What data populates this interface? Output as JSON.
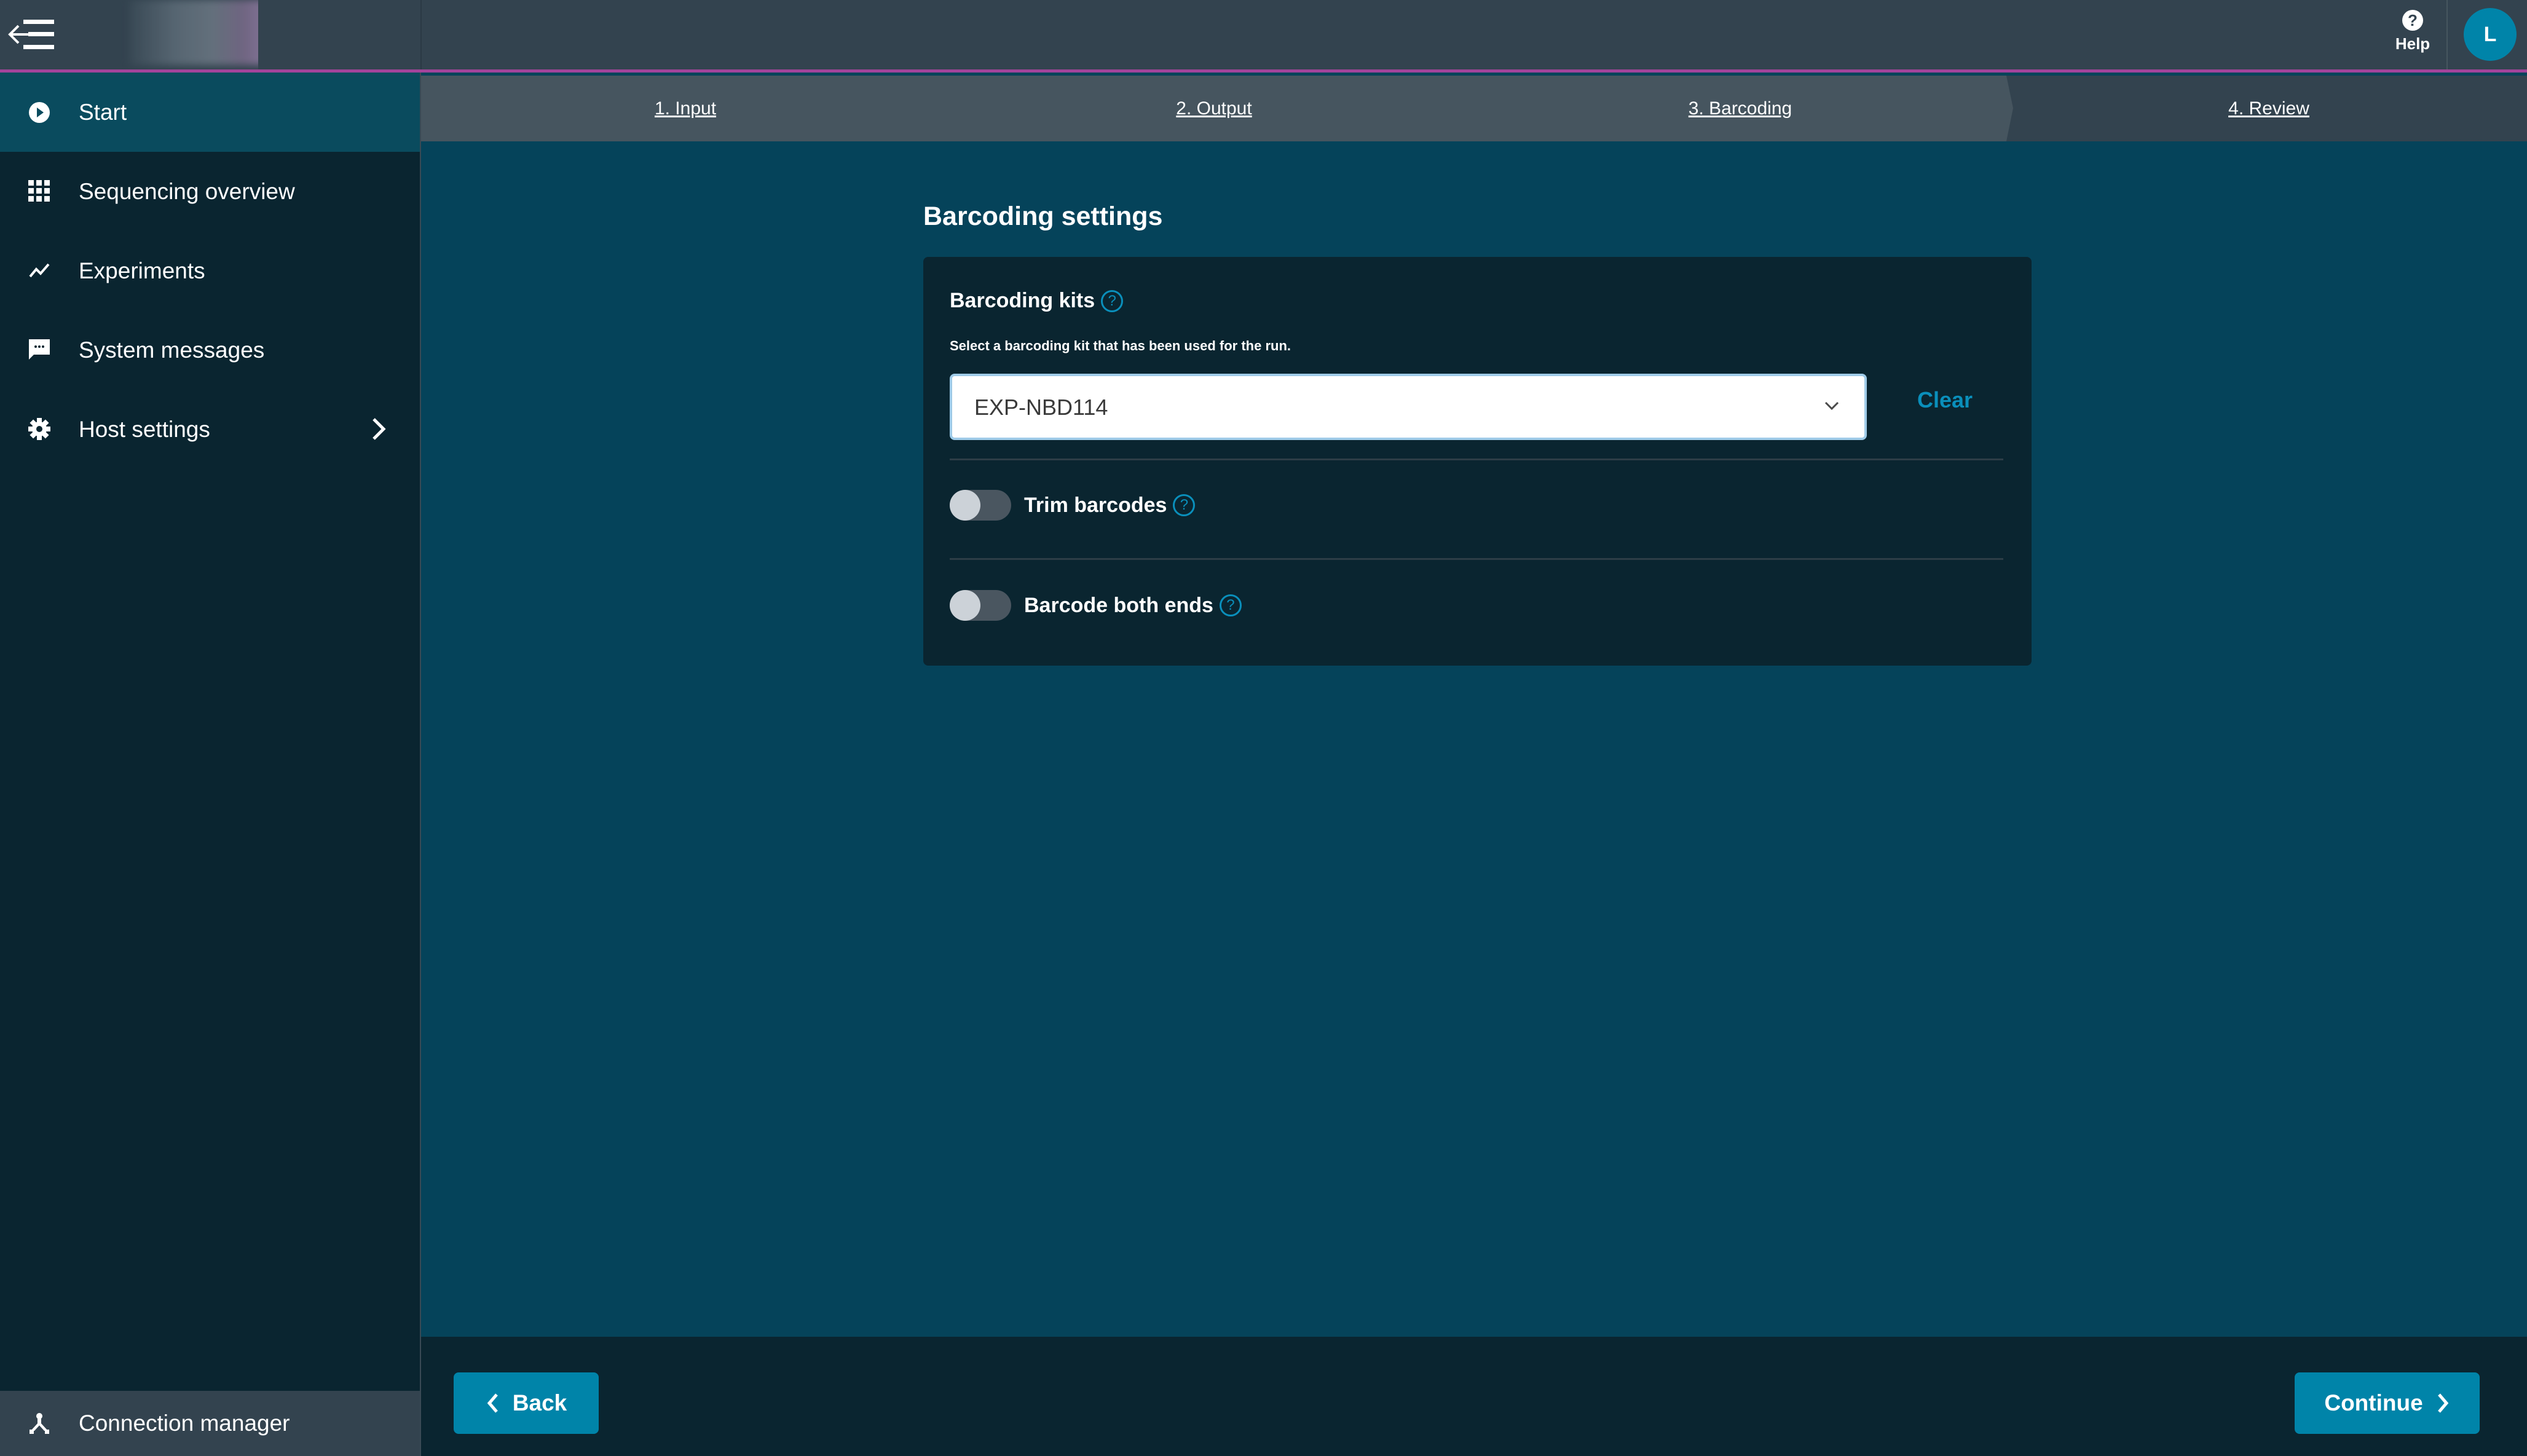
{
  "header": {
    "menu_icon": "collapse-menu-icon",
    "logo": "app-logo (redacted)",
    "help_label": "Help",
    "help_icon": "question-circle-icon",
    "avatar_initial": "L"
  },
  "sidebar": {
    "items": [
      {
        "label": "Start",
        "icon": "play-circle-icon",
        "active": true
      },
      {
        "label": "Sequencing overview",
        "icon": "grid-icon",
        "active": false
      },
      {
        "label": "Experiments",
        "icon": "trend-line-icon",
        "active": false
      },
      {
        "label": "System messages",
        "icon": "chat-bubble-icon",
        "active": false
      },
      {
        "label": "Host settings",
        "icon": "gear-icon",
        "active": false,
        "has_submenu": true
      }
    ],
    "footer_item": {
      "label": "Connection manager",
      "icon": "network-icon"
    }
  },
  "stepper": {
    "steps": [
      {
        "label": "1. Input",
        "state": "completed"
      },
      {
        "label": "2. Output",
        "state": "completed"
      },
      {
        "label": "3. Barcoding",
        "state": "current"
      },
      {
        "label": "4. Review",
        "state": "upcoming"
      }
    ]
  },
  "main": {
    "title": "Barcoding settings",
    "barcoding_kits": {
      "label": "Barcoding kits",
      "helper_text": "Select a barcoding kit that has been used for the run.",
      "selected_value": "EXP-NBD114",
      "clear_label": "Clear"
    },
    "toggles": [
      {
        "label": "Trim barcodes",
        "on": false
      },
      {
        "label": "Barcode both ends",
        "on": false
      }
    ]
  },
  "footer": {
    "back_label": "Back",
    "continue_label": "Continue"
  },
  "colors": {
    "accent": "#0084a9",
    "link": "#0a8fbb",
    "header_border": "#a3449b",
    "background": "#05435a",
    "panel": "#0a2530"
  }
}
